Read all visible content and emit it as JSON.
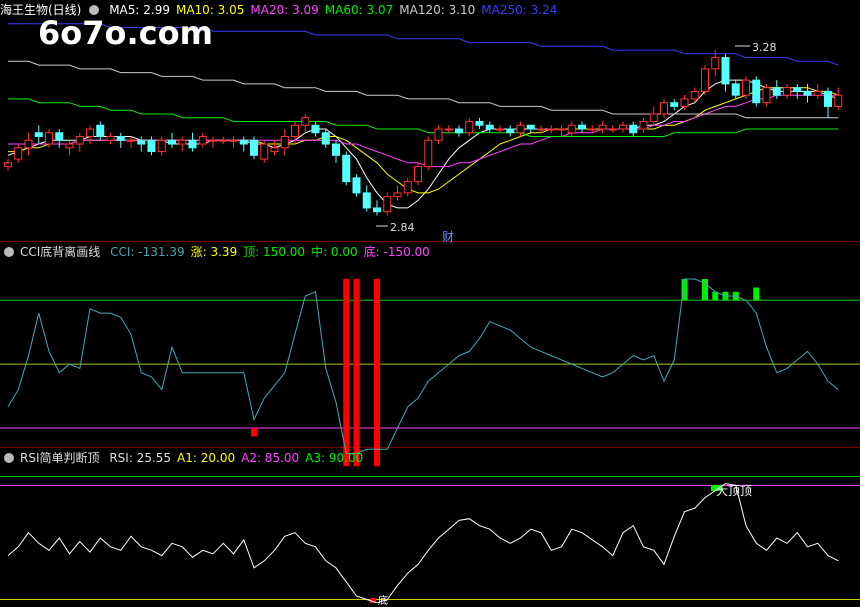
{
  "watermark": "6o7o.com",
  "panels": {
    "main": {
      "name": "海王生物(日线)",
      "indicators": [
        {
          "label": "MA5: 2.99",
          "color": "#ffffff"
        },
        {
          "label": "MA10: 3.05",
          "color": "#ffff00"
        },
        {
          "label": "MA20: 3.09",
          "color": "#ff44ff"
        },
        {
          "label": "MA60: 3.07",
          "color": "#00ee00"
        },
        {
          "label": "MA120: 3.10",
          "color": "#cccccc"
        },
        {
          "label": "MA250: 3.24",
          "color": "#3a3aff"
        }
      ],
      "high_label": "3.28",
      "low_label": "2.84",
      "fin_badge": "财"
    },
    "cci": {
      "name": "CCI底背离画线",
      "indicators": [
        {
          "label": "CCI: -131.39",
          "color": "#4aa6b8"
        },
        {
          "label": "涨: 3.39",
          "color": "#ffff00"
        },
        {
          "label": "顶: 150.00",
          "color": "#00ee00"
        },
        {
          "label": "中: 0.00",
          "color": "#00ee00"
        },
        {
          "label": "底: -150.00",
          "color": "#ff44ff"
        }
      ]
    },
    "rsi": {
      "name": "RSI简单判断顶",
      "indicators": [
        {
          "label": "RSI: 25.55",
          "color": "#dddddd"
        },
        {
          "label": "A1: 20.00",
          "color": "#ffff00"
        },
        {
          "label": "A2: 85.00",
          "color": "#ff44ff"
        },
        {
          "label": "A3: 90.00",
          "color": "#00ee00"
        }
      ],
      "top_label": "大顶顶",
      "bottom_label": "底"
    }
  },
  "chart_data": [
    {
      "type": "candlestick",
      "ylim": [
        2.78,
        3.36
      ],
      "candles": [
        [
          2.97,
          2.98,
          2.96,
          2.99
        ],
        [
          2.99,
          3.02,
          2.98,
          3.03
        ],
        [
          3.02,
          3.04,
          3.0,
          3.06
        ],
        [
          3.06,
          3.05,
          3.03,
          3.08
        ],
        [
          3.03,
          3.06,
          3.02,
          3.07
        ],
        [
          3.06,
          3.04,
          3.02,
          3.07
        ],
        [
          3.02,
          3.03,
          3.0,
          3.04
        ],
        [
          3.03,
          3.05,
          3.01,
          3.06
        ],
        [
          3.05,
          3.07,
          3.03,
          3.08
        ],
        [
          3.08,
          3.05,
          3.04,
          3.09
        ],
        [
          3.04,
          3.05,
          3.03,
          3.06
        ],
        [
          3.05,
          3.04,
          3.02,
          3.06
        ],
        [
          3.04,
          3.04,
          3.02,
          3.05
        ],
        [
          3.04,
          3.03,
          3.01,
          3.05
        ],
        [
          3.04,
          3.01,
          3.0,
          3.05
        ],
        [
          3.01,
          3.04,
          3.0,
          3.05
        ],
        [
          3.04,
          3.03,
          3.02,
          3.06
        ],
        [
          3.03,
          3.04,
          3.01,
          3.05
        ],
        [
          3.04,
          3.02,
          3.01,
          3.06
        ],
        [
          3.03,
          3.05,
          3.02,
          3.06
        ],
        [
          3.04,
          3.04,
          3.02,
          3.05
        ],
        [
          3.04,
          3.04,
          3.03,
          3.05
        ],
        [
          3.04,
          3.04,
          3.02,
          3.05
        ],
        [
          3.04,
          3.03,
          3.01,
          3.05
        ],
        [
          3.04,
          3.0,
          2.99,
          3.05
        ],
        [
          2.99,
          3.03,
          2.98,
          3.04
        ],
        [
          3.01,
          3.02,
          3.0,
          3.04
        ],
        [
          3.02,
          3.05,
          3.0,
          3.07
        ],
        [
          3.05,
          3.08,
          3.03,
          3.09
        ],
        [
          3.08,
          3.1,
          3.06,
          3.11
        ],
        [
          3.08,
          3.06,
          3.05,
          3.09
        ],
        [
          3.06,
          3.03,
          3.02,
          3.07
        ],
        [
          3.03,
          3.0,
          2.98,
          3.04
        ],
        [
          3.0,
          2.93,
          2.92,
          3.01
        ],
        [
          2.94,
          2.9,
          2.89,
          2.95
        ],
        [
          2.9,
          2.86,
          2.85,
          2.92
        ],
        [
          2.86,
          2.85,
          2.84,
          2.88
        ],
        [
          2.85,
          2.89,
          2.84,
          2.9
        ],
        [
          2.89,
          2.9,
          2.88,
          2.92
        ],
        [
          2.9,
          2.93,
          2.89,
          2.94
        ],
        [
          2.93,
          2.97,
          2.92,
          2.98
        ],
        [
          2.97,
          3.04,
          2.96,
          3.05
        ],
        [
          3.04,
          3.07,
          3.03,
          3.08
        ],
        [
          3.07,
          3.07,
          3.06,
          3.08
        ],
        [
          3.07,
          3.06,
          3.05,
          3.08
        ],
        [
          3.06,
          3.09,
          3.05,
          3.1
        ],
        [
          3.09,
          3.08,
          3.07,
          3.1
        ],
        [
          3.08,
          3.07,
          3.06,
          3.09
        ],
        [
          3.07,
          3.07,
          3.06,
          3.08
        ],
        [
          3.07,
          3.06,
          3.05,
          3.08
        ],
        [
          3.06,
          3.08,
          3.05,
          3.09
        ],
        [
          3.08,
          3.07,
          3.06,
          3.08
        ],
        [
          3.07,
          3.07,
          3.06,
          3.08
        ],
        [
          3.07,
          3.07,
          3.06,
          3.08
        ],
        [
          3.07,
          3.07,
          3.05,
          3.08
        ],
        [
          3.06,
          3.08,
          3.05,
          3.09
        ],
        [
          3.08,
          3.07,
          3.06,
          3.09
        ],
        [
          3.07,
          3.07,
          3.06,
          3.08
        ],
        [
          3.07,
          3.08,
          3.06,
          3.09
        ],
        [
          3.07,
          3.07,
          3.06,
          3.08
        ],
        [
          3.07,
          3.08,
          3.06,
          3.09
        ],
        [
          3.08,
          3.06,
          3.05,
          3.09
        ],
        [
          3.07,
          3.09,
          3.06,
          3.1
        ],
        [
          3.09,
          3.11,
          3.08,
          3.13
        ],
        [
          3.11,
          3.14,
          3.1,
          3.15
        ],
        [
          3.14,
          3.13,
          3.12,
          3.15
        ],
        [
          3.13,
          3.15,
          3.12,
          3.16
        ],
        [
          3.15,
          3.17,
          3.14,
          3.18
        ],
        [
          3.17,
          3.23,
          3.16,
          3.24
        ],
        [
          3.23,
          3.26,
          3.21,
          3.28
        ],
        [
          3.26,
          3.19,
          3.17,
          3.27
        ],
        [
          3.19,
          3.16,
          3.15,
          3.2
        ],
        [
          3.16,
          3.2,
          3.15,
          3.21
        ],
        [
          3.2,
          3.14,
          3.13,
          3.21
        ],
        [
          3.14,
          3.18,
          3.13,
          3.19
        ],
        [
          3.18,
          3.16,
          3.15,
          3.2
        ],
        [
          3.16,
          3.18,
          3.15,
          3.19
        ],
        [
          3.18,
          3.17,
          3.15,
          3.19
        ],
        [
          3.17,
          3.16,
          3.14,
          3.19
        ],
        [
          3.16,
          3.17,
          3.15,
          3.19
        ],
        [
          3.17,
          3.13,
          3.1,
          3.18
        ],
        [
          3.13,
          3.16,
          3.12,
          3.18
        ]
      ],
      "ma": {
        "MA5": [
          3.0,
          3.01,
          3.02,
          3.03,
          3.04,
          3.04,
          3.04,
          3.04,
          3.05,
          3.05,
          3.05,
          3.05,
          3.05,
          3.04,
          3.04,
          3.04,
          3.03,
          3.03,
          3.03,
          3.03,
          3.04,
          3.04,
          3.04,
          3.04,
          3.03,
          3.03,
          3.02,
          3.03,
          3.04,
          3.06,
          3.07,
          3.07,
          3.05,
          3.02,
          2.99,
          2.94,
          2.9,
          2.87,
          2.86,
          2.86,
          2.88,
          2.91,
          2.95,
          2.99,
          3.02,
          3.04,
          3.06,
          3.07,
          3.07,
          3.07,
          3.07,
          3.07,
          3.07,
          3.07,
          3.07,
          3.07,
          3.07,
          3.07,
          3.07,
          3.07,
          3.07,
          3.07,
          3.08,
          3.08,
          3.09,
          3.11,
          3.13,
          3.14,
          3.17,
          3.19,
          3.2,
          3.2,
          3.2,
          3.19,
          3.18,
          3.17,
          3.17,
          3.17,
          3.17,
          3.17,
          3.16,
          3.15
        ],
        "MA10": [
          3.01,
          3.01,
          3.02,
          3.02,
          3.03,
          3.03,
          3.03,
          3.04,
          3.04,
          3.04,
          3.04,
          3.04,
          3.04,
          3.04,
          3.04,
          3.04,
          3.04,
          3.04,
          3.04,
          3.04,
          3.04,
          3.04,
          3.04,
          3.04,
          3.04,
          3.03,
          3.03,
          3.03,
          3.03,
          3.04,
          3.04,
          3.05,
          3.05,
          3.04,
          3.02,
          3.0,
          2.98,
          2.95,
          2.93,
          2.91,
          2.9,
          2.9,
          2.91,
          2.93,
          2.95,
          2.97,
          2.99,
          3.01,
          3.03,
          3.04,
          3.05,
          3.06,
          3.06,
          3.07,
          3.07,
          3.07,
          3.07,
          3.07,
          3.07,
          3.07,
          3.07,
          3.07,
          3.07,
          3.07,
          3.08,
          3.08,
          3.09,
          3.1,
          3.12,
          3.13,
          3.14,
          3.15,
          3.16,
          3.17,
          3.18,
          3.18,
          3.18,
          3.18,
          3.18,
          3.17,
          3.17,
          3.16
        ],
        "MA20": [
          3.03,
          3.03,
          3.03,
          3.03,
          3.03,
          3.03,
          3.03,
          3.04,
          3.04,
          3.04,
          3.04,
          3.04,
          3.04,
          3.04,
          3.04,
          3.04,
          3.04,
          3.04,
          3.04,
          3.04,
          3.04,
          3.04,
          3.04,
          3.04,
          3.04,
          3.04,
          3.04,
          3.04,
          3.04,
          3.04,
          3.04,
          3.04,
          3.04,
          3.03,
          3.03,
          3.02,
          3.01,
          3.0,
          2.99,
          2.98,
          2.98,
          2.97,
          2.97,
          2.97,
          2.98,
          2.98,
          2.99,
          3.0,
          3.01,
          3.02,
          3.03,
          3.03,
          3.04,
          3.05,
          3.05,
          3.06,
          3.06,
          3.06,
          3.07,
          3.07,
          3.07,
          3.07,
          3.07,
          3.08,
          3.08,
          3.09,
          3.09,
          3.1,
          3.11,
          3.12,
          3.13,
          3.13,
          3.14,
          3.15,
          3.15,
          3.16,
          3.16,
          3.16,
          3.16,
          3.16,
          3.16,
          3.16
        ],
        "MA60": [
          3.15,
          3.15,
          3.15,
          3.14,
          3.14,
          3.14,
          3.14,
          3.13,
          3.13,
          3.13,
          3.12,
          3.12,
          3.12,
          3.11,
          3.11,
          3.11,
          3.11,
          3.1,
          3.1,
          3.1,
          3.1,
          3.1,
          3.09,
          3.09,
          3.09,
          3.09,
          3.09,
          3.09,
          3.09,
          3.09,
          3.09,
          3.09,
          3.08,
          3.08,
          3.08,
          3.08,
          3.07,
          3.07,
          3.07,
          3.07,
          3.07,
          3.06,
          3.06,
          3.06,
          3.06,
          3.06,
          3.06,
          3.06,
          3.06,
          3.06,
          3.06,
          3.05,
          3.05,
          3.05,
          3.05,
          3.05,
          3.05,
          3.05,
          3.05,
          3.05,
          3.05,
          3.05,
          3.05,
          3.05,
          3.05,
          3.06,
          3.06,
          3.06,
          3.06,
          3.06,
          3.06,
          3.06,
          3.07,
          3.07,
          3.07,
          3.07,
          3.07,
          3.07,
          3.07,
          3.07,
          3.07,
          3.07
        ],
        "MA120": [
          3.25,
          3.25,
          3.25,
          3.24,
          3.24,
          3.24,
          3.24,
          3.23,
          3.23,
          3.23,
          3.23,
          3.22,
          3.22,
          3.22,
          3.22,
          3.21,
          3.21,
          3.21,
          3.21,
          3.2,
          3.2,
          3.2,
          3.2,
          3.19,
          3.19,
          3.19,
          3.19,
          3.18,
          3.18,
          3.18,
          3.18,
          3.17,
          3.17,
          3.17,
          3.17,
          3.16,
          3.16,
          3.16,
          3.16,
          3.15,
          3.15,
          3.15,
          3.15,
          3.15,
          3.14,
          3.14,
          3.14,
          3.14,
          3.13,
          3.13,
          3.13,
          3.13,
          3.13,
          3.12,
          3.12,
          3.12,
          3.12,
          3.12,
          3.12,
          3.11,
          3.11,
          3.11,
          3.11,
          3.11,
          3.11,
          3.11,
          3.11,
          3.11,
          3.11,
          3.11,
          3.11,
          3.11,
          3.1,
          3.1,
          3.1,
          3.1,
          3.1,
          3.1,
          3.1,
          3.1,
          3.1,
          3.1
        ],
        "MA250": [
          3.35,
          3.35,
          3.35,
          3.35,
          3.35,
          3.35,
          3.35,
          3.35,
          3.35,
          3.35,
          3.34,
          3.34,
          3.34,
          3.34,
          3.34,
          3.34,
          3.34,
          3.34,
          3.34,
          3.34,
          3.33,
          3.33,
          3.33,
          3.33,
          3.33,
          3.33,
          3.33,
          3.33,
          3.33,
          3.33,
          3.32,
          3.32,
          3.32,
          3.32,
          3.32,
          3.32,
          3.32,
          3.32,
          3.31,
          3.31,
          3.31,
          3.31,
          3.31,
          3.31,
          3.31,
          3.3,
          3.3,
          3.3,
          3.3,
          3.3,
          3.3,
          3.3,
          3.29,
          3.29,
          3.29,
          3.29,
          3.29,
          3.29,
          3.29,
          3.28,
          3.28,
          3.28,
          3.28,
          3.28,
          3.28,
          3.28,
          3.27,
          3.27,
          3.27,
          3.27,
          3.27,
          3.27,
          3.26,
          3.26,
          3.26,
          3.26,
          3.26,
          3.25,
          3.25,
          3.25,
          3.25,
          3.24
        ]
      }
    },
    {
      "type": "line",
      "ylim": [
        -190,
        240
      ],
      "levels": {
        "top": 150,
        "mid": 0,
        "bottom": -150
      },
      "cci": [
        -100,
        -60,
        20,
        120,
        30,
        -20,
        0,
        -10,
        130,
        120,
        120,
        110,
        70,
        -20,
        -30,
        -60,
        40,
        -20,
        -20,
        -20,
        -20,
        -20,
        -20,
        -20,
        -130,
        -80,
        -50,
        -20,
        70,
        160,
        170,
        -10,
        -90,
        -210,
        -210,
        -200,
        -200,
        -200,
        -150,
        -100,
        -80,
        -40,
        -20,
        0,
        20,
        30,
        60,
        100,
        90,
        80,
        60,
        40,
        30,
        20,
        10,
        0,
        -10,
        -20,
        -30,
        -20,
        0,
        20,
        10,
        20,
        -40,
        10,
        200,
        200,
        190,
        170,
        160,
        160,
        150,
        120,
        40,
        -20,
        -10,
        10,
        30,
        0,
        -40,
        -60
      ],
      "red_bars": [
        {
          "i": 24,
          "v": -170
        },
        {
          "i": 33,
          "v": -240
        },
        {
          "i": 34,
          "v": -240
        },
        {
          "i": 36,
          "v": -240
        }
      ],
      "green_bars": [
        {
          "i": 66,
          "v": 200
        },
        {
          "i": 68,
          "v": 200
        },
        {
          "i": 69,
          "v": 170
        },
        {
          "i": 70,
          "v": 170
        },
        {
          "i": 71,
          "v": 170
        },
        {
          "i": 73,
          "v": 180
        }
      ]
    },
    {
      "type": "line",
      "ylim": [
        18,
        96
      ],
      "levels": {
        "A1": 20,
        "A2": 85,
        "A3": 90
      },
      "rsi": [
        45,
        50,
        58,
        52,
        48,
        55,
        46,
        53,
        47,
        55,
        50,
        48,
        56,
        50,
        48,
        45,
        52,
        50,
        44,
        48,
        46,
        52,
        46,
        54,
        38,
        42,
        48,
        56,
        58,
        52,
        50,
        42,
        38,
        30,
        22,
        20,
        18,
        20,
        28,
        35,
        40,
        48,
        55,
        60,
        65,
        66,
        62,
        60,
        55,
        52,
        55,
        60,
        58,
        48,
        50,
        60,
        58,
        54,
        50,
        45,
        58,
        62,
        50,
        48,
        40,
        56,
        70,
        72,
        78,
        82,
        86,
        85,
        62,
        52,
        48,
        55,
        52,
        58,
        50,
        52,
        45,
        42
      ]
    }
  ]
}
